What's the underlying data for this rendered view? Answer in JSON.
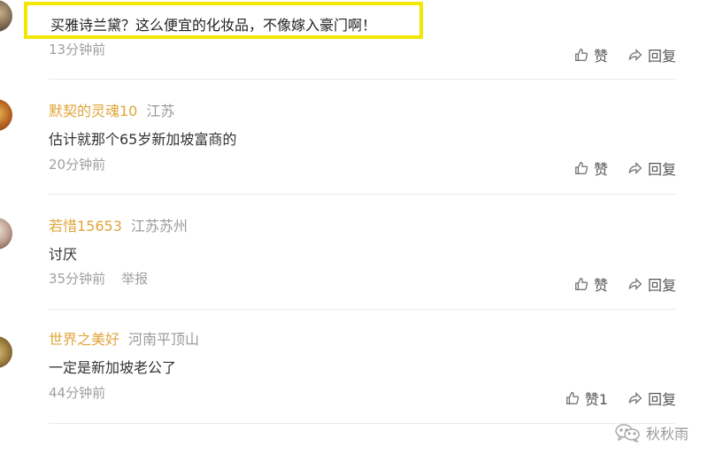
{
  "comments": [
    {
      "text": "买雅诗兰黛？这么便宜的化妆品，不像嫁入豪门啊！",
      "time": "13分钟前",
      "like_label": "赞",
      "reply_label": "回复"
    },
    {
      "username": "默契的灵魂10",
      "location": "江苏",
      "text": "估计就那个65岁新加坡富商的",
      "time": "20分钟前",
      "like_label": "赞",
      "reply_label": "回复"
    },
    {
      "username": "若惜15653",
      "location": "江苏苏州",
      "text": "讨厌",
      "time": "35分钟前",
      "report_label": "举报",
      "like_label": "赞",
      "reply_label": "回复"
    },
    {
      "username": "世界之美好",
      "location": "河南平顶山",
      "text": "一定是新加坡老公了",
      "time": "44分钟前",
      "like_label": "赞1",
      "reply_label": "回复"
    }
  ],
  "watermark": {
    "text": "秋秋雨",
    "icon": "wechat-icon"
  },
  "colors": {
    "username": "#e0a53a",
    "highlight_border": "#f3e600",
    "muted": "#a0a0a0"
  }
}
